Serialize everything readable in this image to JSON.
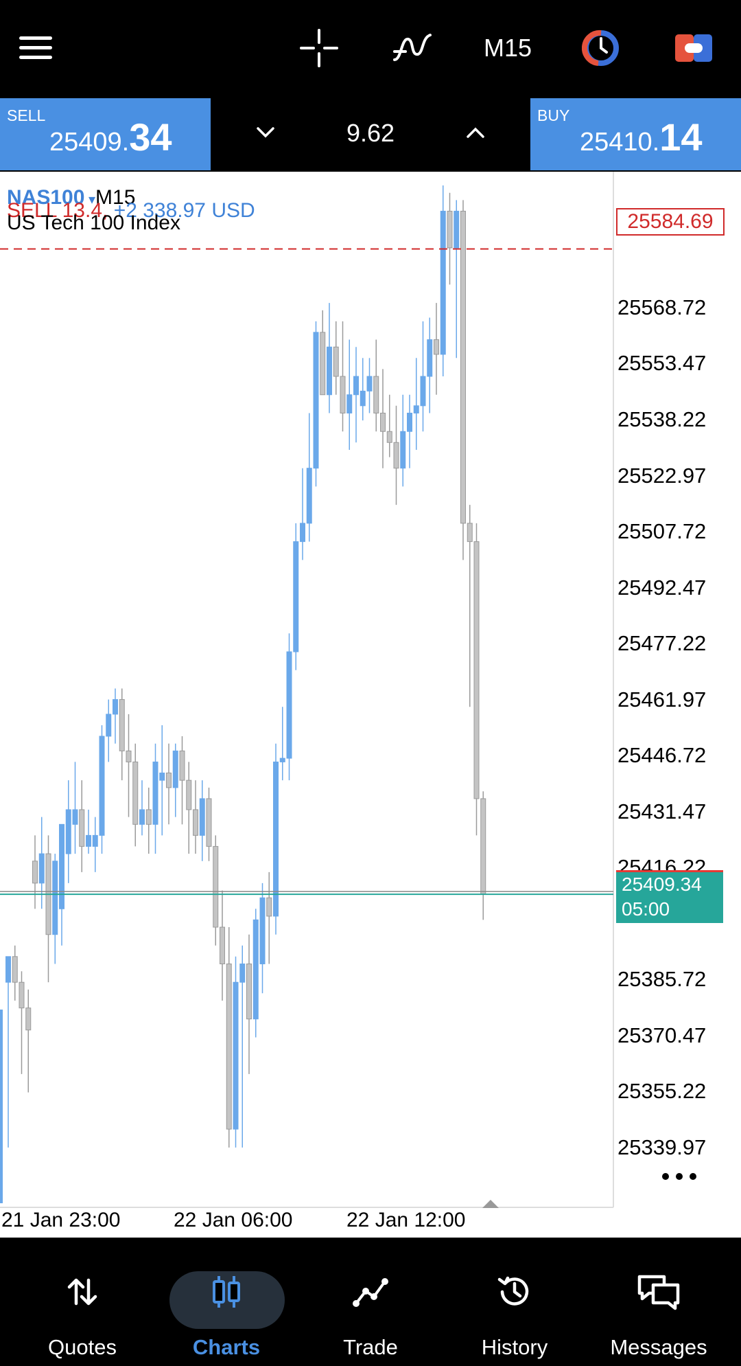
{
  "toolbar": {
    "timeframe": "M15"
  },
  "price_bar": {
    "sell_label": "SELL",
    "sell_price_small": "25409.",
    "sell_price_big": "34",
    "spread": "9.62",
    "buy_label": "BUY",
    "buy_price_small": "25410.",
    "buy_price_big": "14"
  },
  "chart": {
    "symbol": "NAS100",
    "timeframe": "M15",
    "trade_line": "SELL 13.4,",
    "trade_profit": "+2 338.97 USD",
    "description": "US Tech 100 Index",
    "trade_price": "25584.69",
    "bid_price": "25409.34",
    "bar_timer": "05:00",
    "price_axis": [
      "25568.72",
      "25553.47",
      "25538.22",
      "25522.97",
      "25507.72",
      "25492.47",
      "25477.22",
      "25461.97",
      "25446.72",
      "25431.47",
      "25416.22",
      "25385.72",
      "25370.47",
      "25355.22",
      "25339.97"
    ],
    "time_axis": [
      "21 Jan 23:00",
      "22 Jan 06:00",
      "22 Jan 12:00"
    ],
    "colors": {
      "bull": "#6aa8ea",
      "bear": "#c4c4c4",
      "trade_line": "#d02a2a",
      "bid_line": "#26a69a"
    }
  },
  "chart_data": {
    "type": "candlestick",
    "symbol": "NAS100",
    "timeframe": "M15",
    "ylim": [
      25328,
      25602
    ],
    "candles": [
      [
        25385,
        25392,
        25340,
        25392
      ],
      [
        25392,
        25395,
        25380,
        25385
      ],
      [
        25385,
        25388,
        25360,
        25378
      ],
      [
        25378,
        25383,
        25355,
        25372
      ],
      [
        25418,
        25425,
        25405,
        25412
      ],
      [
        25412,
        25430,
        25405,
        25420
      ],
      [
        25420,
        25425,
        25385,
        25398
      ],
      [
        25398,
        25420,
        25390,
        25418
      ],
      [
        25405,
        25425,
        25395,
        25428
      ],
      [
        25420,
        25440,
        25412,
        25432
      ],
      [
        25428,
        25445,
        25420,
        25432
      ],
      [
        25432,
        25440,
        25415,
        25422
      ],
      [
        25422,
        25432,
        25420,
        25425
      ],
      [
        25422,
        25430,
        25415,
        25425
      ],
      [
        25425,
        25455,
        25420,
        25452
      ],
      [
        25452,
        25462,
        25445,
        25458
      ],
      [
        25458,
        25465,
        25450,
        25462
      ],
      [
        25462,
        25465,
        25440,
        25448
      ],
      [
        25448,
        25458,
        25430,
        25445
      ],
      [
        25445,
        25450,
        25422,
        25428
      ],
      [
        25428,
        25440,
        25425,
        25432
      ],
      [
        25432,
        25438,
        25420,
        25428
      ],
      [
        25428,
        25450,
        25420,
        25445
      ],
      [
        25440,
        25455,
        25425,
        25442
      ],
      [
        25442,
        25450,
        25428,
        25438
      ],
      [
        25438,
        25450,
        25430,
        25448
      ],
      [
        25448,
        25452,
        25428,
        25440
      ],
      [
        25440,
        25445,
        25420,
        25432
      ],
      [
        25432,
        25440,
        25420,
        25425
      ],
      [
        25425,
        25440,
        25418,
        25435
      ],
      [
        25435,
        25438,
        25418,
        25422
      ],
      [
        25422,
        25425,
        25395,
        25400
      ],
      [
        25400,
        25410,
        25380,
        25390
      ],
      [
        25390,
        25400,
        25340,
        25345
      ],
      [
        25345,
        25392,
        25340,
        25385
      ],
      [
        25385,
        25395,
        25340,
        25390
      ],
      [
        25390,
        25398,
        25360,
        25375
      ],
      [
        25375,
        25405,
        25370,
        25402
      ],
      [
        25390,
        25412,
        25382,
        25408
      ],
      [
        25408,
        25415,
        25390,
        25403
      ],
      [
        25403,
        25450,
        25398,
        25445
      ],
      [
        25445,
        25460,
        25440,
        25446
      ],
      [
        25446,
        25480,
        25440,
        25475
      ],
      [
        25475,
        25510,
        25470,
        25505
      ],
      [
        25505,
        25525,
        25500,
        25510
      ],
      [
        25510,
        25540,
        25505,
        25525
      ],
      [
        25525,
        25565,
        25520,
        25562
      ],
      [
        25562,
        25568,
        25548,
        25545
      ],
      [
        25545,
        25570,
        25540,
        25558
      ],
      [
        25558,
        25565,
        25545,
        25550
      ],
      [
        25550,
        25565,
        25535,
        25540
      ],
      [
        25540,
        25560,
        25530,
        25545
      ],
      [
        25545,
        25558,
        25532,
        25550
      ],
      [
        25542,
        25555,
        25538,
        25546
      ],
      [
        25546,
        25555,
        25540,
        25550
      ],
      [
        25550,
        25560,
        25535,
        25540
      ],
      [
        25540,
        25552,
        25525,
        25535
      ],
      [
        25535,
        25545,
        25528,
        25532
      ],
      [
        25532,
        25542,
        25515,
        25525
      ],
      [
        25525,
        25545,
        25520,
        25535
      ],
      [
        25535,
        25545,
        25525,
        25540
      ],
      [
        25540,
        25555,
        25530,
        25542
      ],
      [
        25542,
        25565,
        25535,
        25550
      ],
      [
        25550,
        25566,
        25540,
        25560
      ],
      [
        25560,
        25570,
        25545,
        25556
      ],
      [
        25556,
        25602,
        25550,
        25595
      ],
      [
        25595,
        25600,
        25575,
        25585
      ],
      [
        25585,
        25598,
        25555,
        25595
      ],
      [
        25595,
        25598,
        25500,
        25510
      ],
      [
        25510,
        25515,
        25460,
        25505
      ],
      [
        25505,
        25510,
        25425,
        25435
      ],
      [
        25435,
        25437,
        25402,
        25409
      ]
    ],
    "trade_price": 25584.69,
    "bid": 25409.34
  },
  "nav": [
    {
      "label": "Quotes"
    },
    {
      "label": "Charts"
    },
    {
      "label": "Trade"
    },
    {
      "label": "History"
    },
    {
      "label": "Messages"
    }
  ]
}
